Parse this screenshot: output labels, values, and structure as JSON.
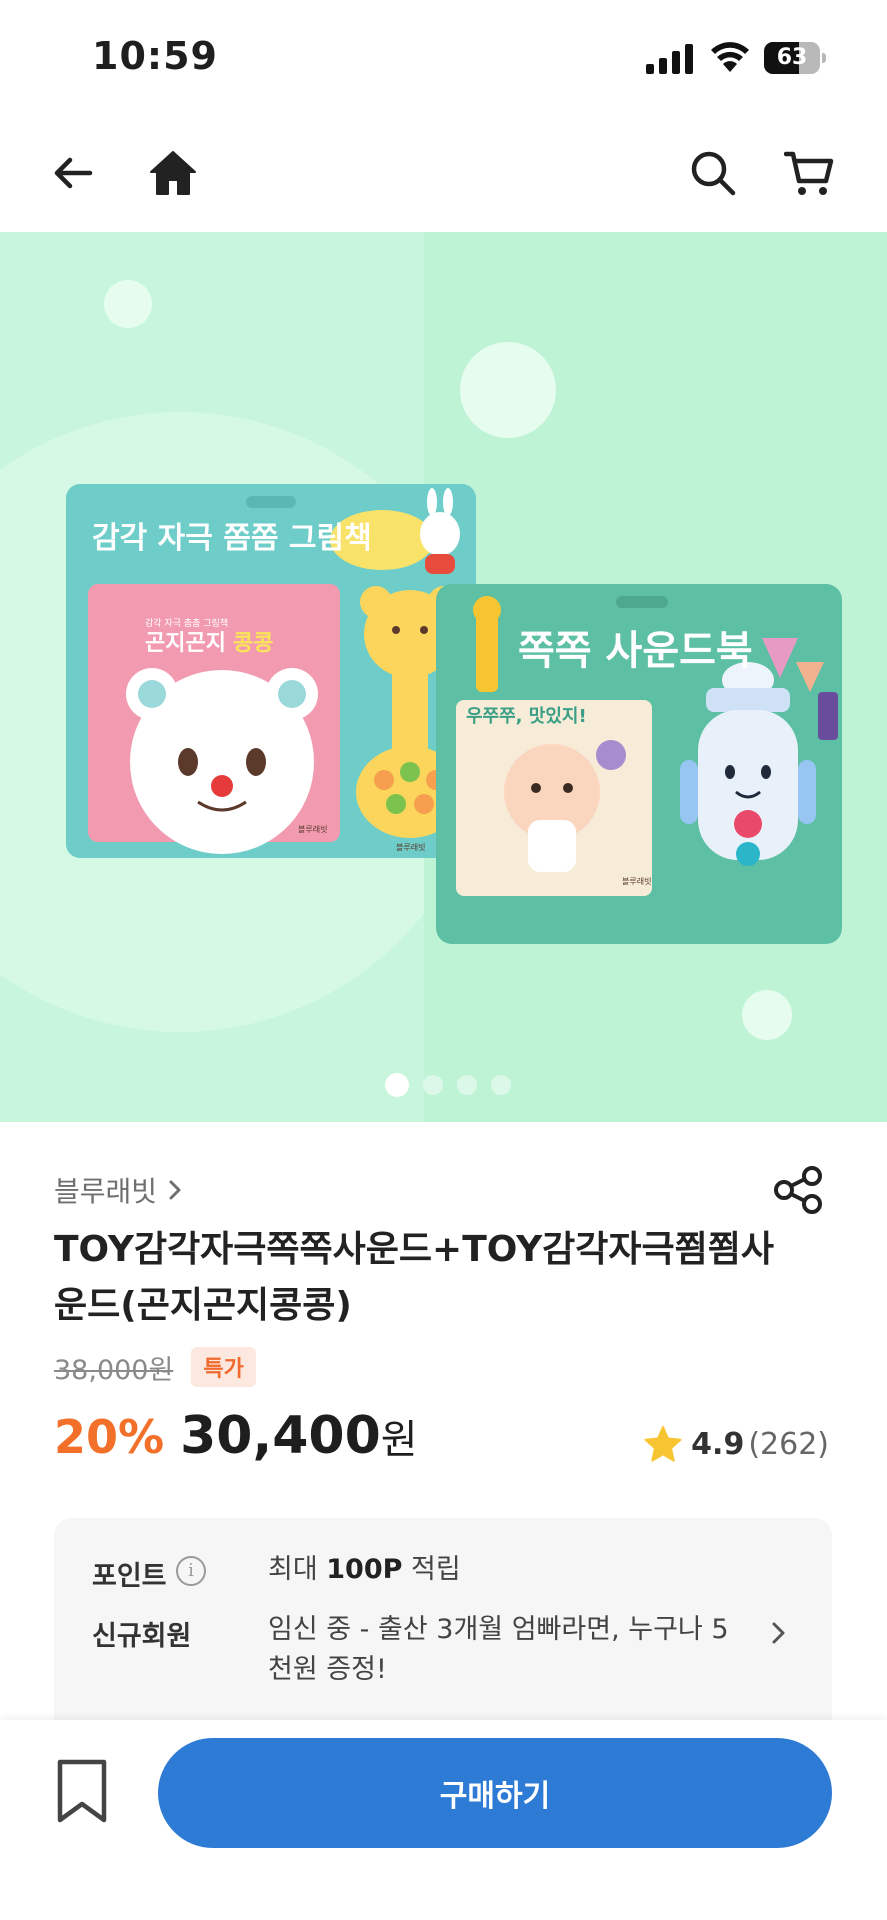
{
  "status_bar": {
    "time": "10:59",
    "battery": "63",
    "battery_level": 0.63,
    "icons": [
      "signal-icon",
      "wifi-icon",
      "battery-icon"
    ]
  },
  "top_nav": {
    "icons": [
      "arrow-left-icon",
      "home-icon",
      "search-icon",
      "cart-icon"
    ]
  },
  "hero": {
    "book1_title": "감각 자극 쫌쫌 그림책",
    "book1_subtitle": "감각 자극 촘촘 그림책",
    "book1_cover_title_a": "곤지곤지",
    "book1_cover_title_b": "콩콩",
    "book1_publisher": "블루래빗",
    "book2_title": "쪽쪽 사운드북",
    "book2_cover_title": "우쭈쭈, 맛있지!",
    "book2_publisher": "블루래빗",
    "carousel": {
      "count": 4,
      "active_index": 0
    },
    "colors": {
      "background": "#c8f6dc",
      "book1_frame": "#6ecdc8",
      "book2_frame": "#5dbfa3"
    }
  },
  "product": {
    "brand": "블루래빗",
    "title": "TOY감각자극쪽쪽사운드+TOY감각자극쬠쬠사운드(곤지곤지콩콩)",
    "original_price": "38,000원",
    "badge": "특가",
    "discount": "20%",
    "price": "30,400",
    "price_unit": "원",
    "rating": "4.9",
    "review_count": "(262)",
    "rating_value": 4.9
  },
  "benefits": {
    "point_label": "포인트",
    "point_text_prefix": "최대 ",
    "point_text_bold": "100P",
    "point_text_suffix": " 적립",
    "newmember_label": "신규회원",
    "newmember_text": "임신 중 - 출산 3개월 엄빠라면, 누구나 5천원 증정!"
  },
  "bottom_bar": {
    "buy_label": "구매하기",
    "bookmark_icon": "bookmark-icon"
  },
  "colors": {
    "accent_blue": "#2e7bd6",
    "discount_orange": "#f2702a",
    "star_yellow": "#f7c531"
  }
}
